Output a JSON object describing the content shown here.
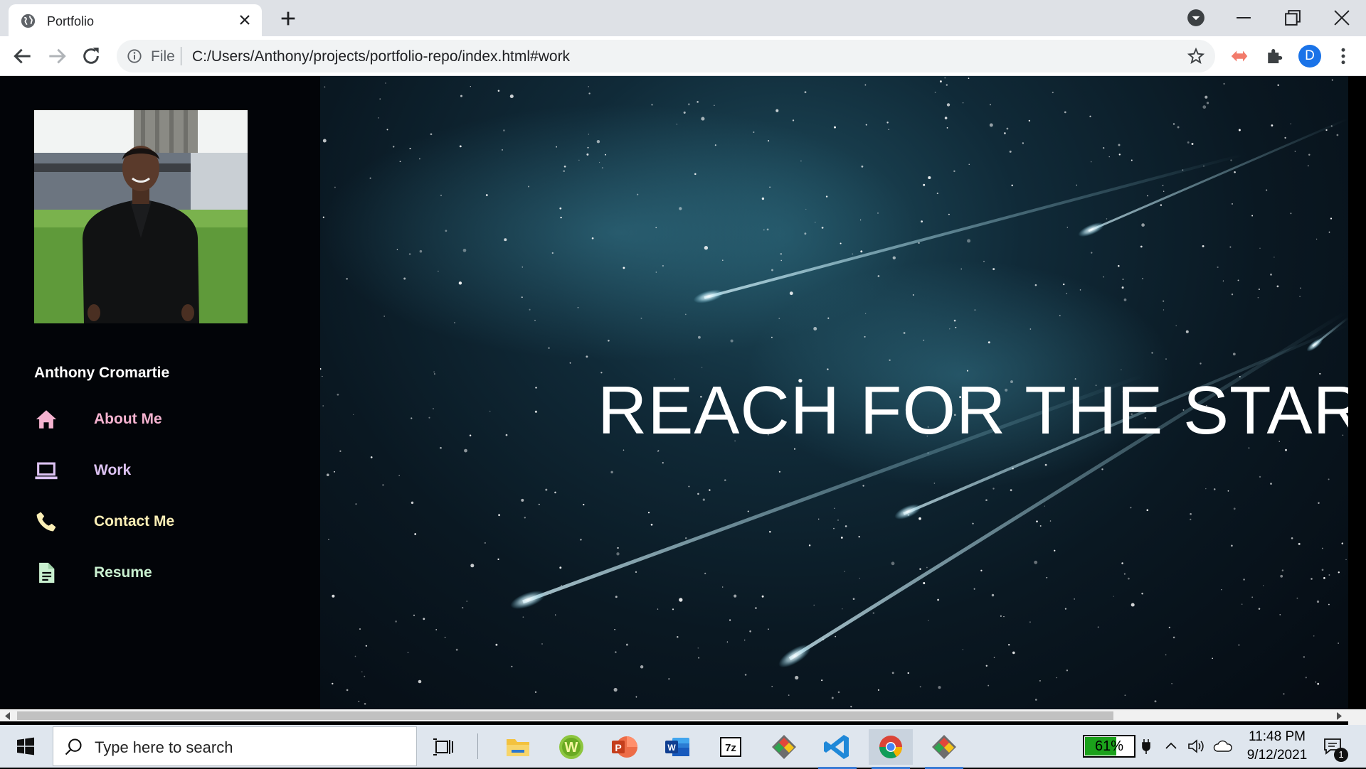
{
  "browser": {
    "tab_title": "Portfolio",
    "omnibox": {
      "scheme": "File",
      "url": "C:/Users/Anthony/projects/portfolio-repo/index.html#work"
    },
    "profile_initial": "D"
  },
  "sidebar": {
    "name": "Anthony Cromartie",
    "nav": [
      {
        "label": "About Me",
        "icon": "home-icon",
        "color": "#f5b3d0"
      },
      {
        "label": "Work",
        "icon": "laptop-icon",
        "color": "#dcc2f2"
      },
      {
        "label": "Contact Me",
        "icon": "phone-icon",
        "color": "#fbefb6"
      },
      {
        "label": "Resume",
        "icon": "document-icon",
        "color": "#c9f0d0"
      }
    ]
  },
  "hero": {
    "title": "REACH FOR THE STARS"
  },
  "taskbar": {
    "search_placeholder": "Type here to search",
    "battery": "61%",
    "time": "11:48 PM",
    "date": "9/12/2021",
    "notification_count": "1"
  }
}
